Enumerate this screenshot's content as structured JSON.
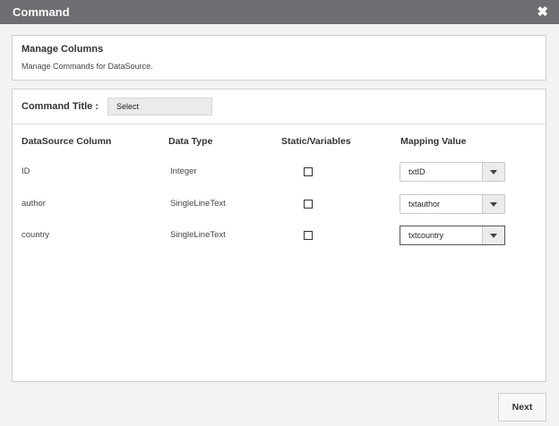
{
  "window": {
    "title": "Command",
    "close_glyph": "✖",
    "close_icon": "close-icon"
  },
  "header": {
    "title": "Manage Columns",
    "subtitle": "Manage Commands for DataSource."
  },
  "command": {
    "label": "Command Title :",
    "selected": "Select"
  },
  "table": {
    "headers": [
      "DataSource Column",
      "Data Type",
      "Static/Variables",
      "Mapping Value"
    ],
    "rows": [
      {
        "column": "ID",
        "type": "Integer",
        "static": false,
        "mapping": "txtID"
      },
      {
        "column": "author",
        "type": "SingleLineText",
        "static": false,
        "mapping": "txtauthor"
      },
      {
        "column": "country",
        "type": "SingleLineText",
        "static": false,
        "mapping": "txtcountry"
      }
    ]
  },
  "footer": {
    "next_label": "Next"
  },
  "colors": {
    "titlebar": "#6d6e71",
    "background": "#f3f3f3"
  }
}
